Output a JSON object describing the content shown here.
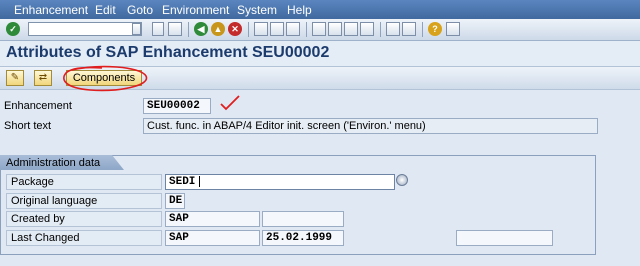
{
  "menu": [
    "Enhancement",
    "Edit",
    "Goto",
    "Environment",
    "System",
    "Help"
  ],
  "toolbar": {
    "icons": [
      "enter-icon",
      "command-field",
      "save-icon",
      "back-icon",
      "exit-icon",
      "cancel-icon",
      "print-icon",
      "find-icon",
      "find-next-icon",
      "first-page-icon",
      "previous-page-icon",
      "next-page-icon",
      "last-page-icon",
      "new-session-icon",
      "shortcut-icon",
      "help-icon",
      "customize-layout-icon"
    ]
  },
  "title": "Attributes of SAP Enhancement SEU00002",
  "app_toolbar": {
    "icons": [
      "change-icon",
      "display-change-icon"
    ],
    "components_label": "Components"
  },
  "fields": {
    "enhancement_label": "Enhancement",
    "enhancement_value": "SEU00002",
    "short_text_label": "Short text",
    "short_text_value": "Cust. func. in ABAP/4 Editor init. screen ('Environ.' menu)"
  },
  "admin": {
    "title": "Administration data",
    "package_label": "Package",
    "package_value": "SEDI",
    "original_language_label": "Original language",
    "original_language_value": "DE",
    "created_by_label": "Created by",
    "created_by_value": "SAP",
    "created_on_value": "",
    "last_changed_label": "Last Changed",
    "last_changed_by": "SAP",
    "last_changed_date": "25.02.1999",
    "last_changed_extra": ""
  },
  "colors": {
    "menu_bar": "#4a76b0",
    "title_text": "#1c3b6d",
    "background": "#dfe8f3",
    "annotation_red": "#e01e1e"
  }
}
